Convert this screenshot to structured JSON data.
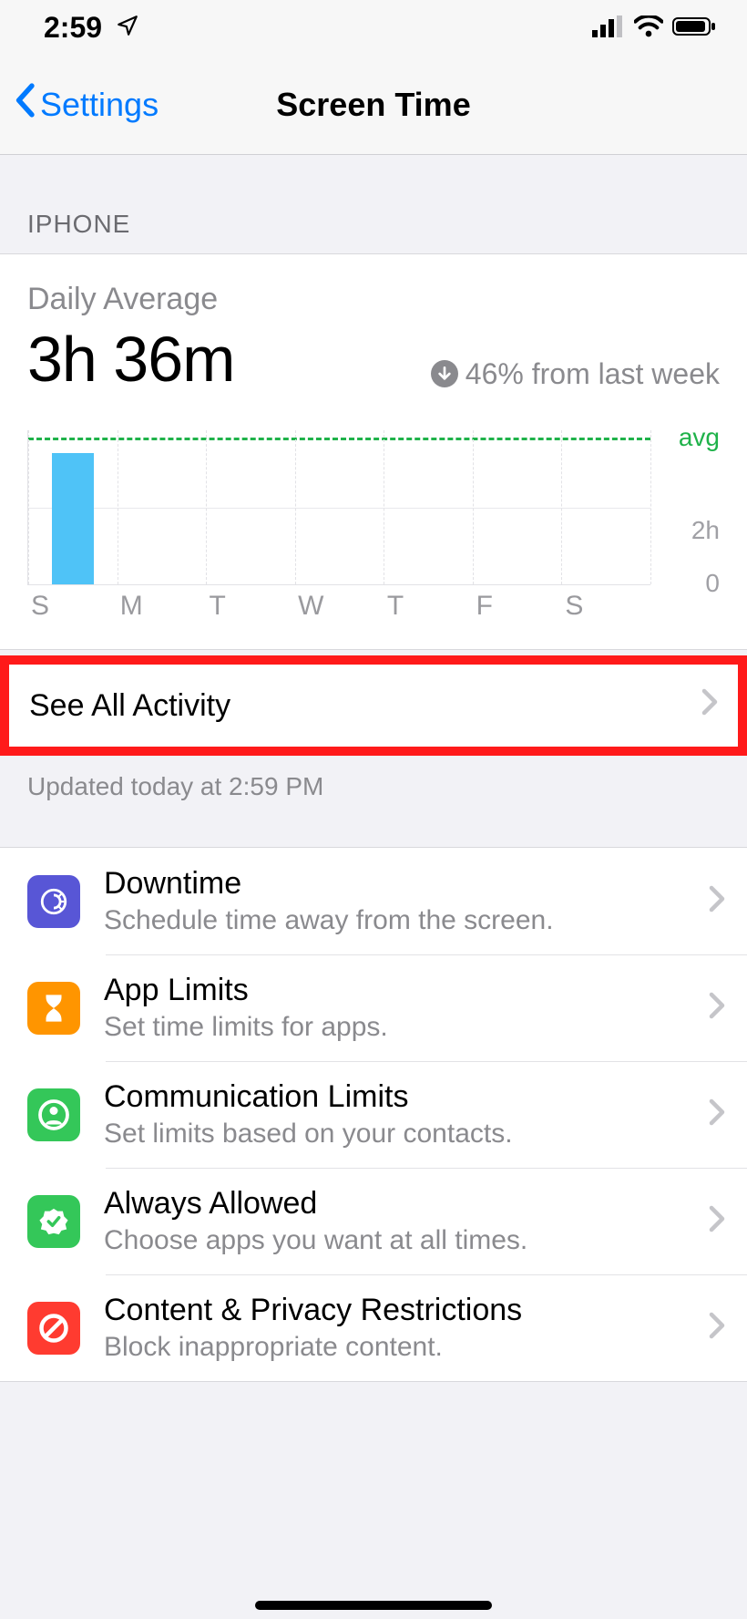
{
  "status_bar": {
    "time": "2:59",
    "location_icon": "location-icon"
  },
  "nav": {
    "back_label": "Settings",
    "title": "Screen Time"
  },
  "section_header": "IPHONE",
  "usage": {
    "label": "Daily Average",
    "value": "3h 36m",
    "delta_text": "46% from last week",
    "delta_direction": "down"
  },
  "chart_data": {
    "type": "bar",
    "categories": [
      "S",
      "M",
      "T",
      "W",
      "T",
      "F",
      "S"
    ],
    "values": [
      3.4,
      0,
      0,
      0,
      0,
      0,
      0
    ],
    "avg_line_value": 3.6,
    "ylabel_unit": "h",
    "ylim": [
      0,
      4
    ],
    "y_ticks": [
      {
        "v": 0,
        "label": "0"
      },
      {
        "v": 2,
        "label": "2h"
      }
    ],
    "avg_label": "avg"
  },
  "see_all": {
    "label": "See All Activity"
  },
  "updated": "Updated today at 2:59 PM",
  "settings": [
    {
      "icon": "downtime-icon",
      "icon_class": "ic-purple",
      "title": "Downtime",
      "sub": "Schedule time away from the screen."
    },
    {
      "icon": "app-limits-icon",
      "icon_class": "ic-orange",
      "title": "App Limits",
      "sub": "Set time limits for apps."
    },
    {
      "icon": "communication-icon",
      "icon_class": "ic-green",
      "title": "Communication Limits",
      "sub": "Set limits based on your contacts."
    },
    {
      "icon": "always-allowed-icon",
      "icon_class": "ic-green",
      "title": "Always Allowed",
      "sub": "Choose apps you want at all times."
    },
    {
      "icon": "restrictions-icon",
      "icon_class": "ic-red",
      "title": "Content & Privacy Restrictions",
      "sub": "Block inappropriate content."
    }
  ]
}
